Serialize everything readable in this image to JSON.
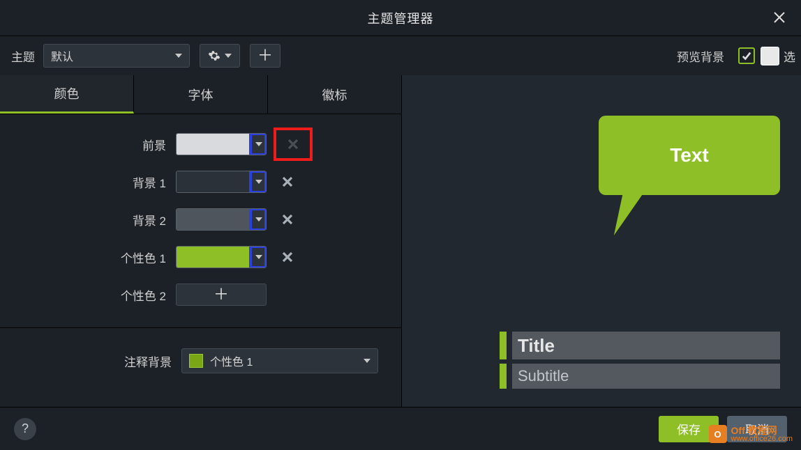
{
  "window": {
    "title": "主题管理器"
  },
  "toolbar": {
    "theme_label": "主题",
    "theme_selected": "默认",
    "preview_bg_label": "预览背景",
    "preview_bg_checked": true,
    "trailing_text": "选"
  },
  "tabs": [
    {
      "label": "颜色",
      "active": true
    },
    {
      "label": "字体",
      "active": false
    },
    {
      "label": "徽标",
      "active": false
    }
  ],
  "colors": {
    "rows": [
      {
        "label": "前景",
        "swatch": "#d8dadd",
        "highlight_dd": true,
        "highlight_del": true
      },
      {
        "label": "背景 1",
        "swatch": "#2b3138",
        "highlight_dd": true,
        "highlight_del": false
      },
      {
        "label": "背景 2",
        "swatch": "#4e555c",
        "highlight_dd": true,
        "highlight_del": false
      },
      {
        "label": "个性色 1",
        "swatch": "#8fbf26",
        "highlight_dd": true,
        "highlight_del": false
      }
    ],
    "add_row_label": "个性色 2"
  },
  "annotation": {
    "label": "注释背景",
    "selected": "个性色 1",
    "swatch": "#7aa514"
  },
  "preview": {
    "bubble_text": "Text",
    "title": "Title",
    "subtitle": "Subtitle"
  },
  "footer": {
    "help": "?",
    "save": "保存",
    "cancel": "取消"
  },
  "watermark": {
    "brand": "Off 教程网",
    "url": "www.office26.com",
    "badge": "O"
  }
}
